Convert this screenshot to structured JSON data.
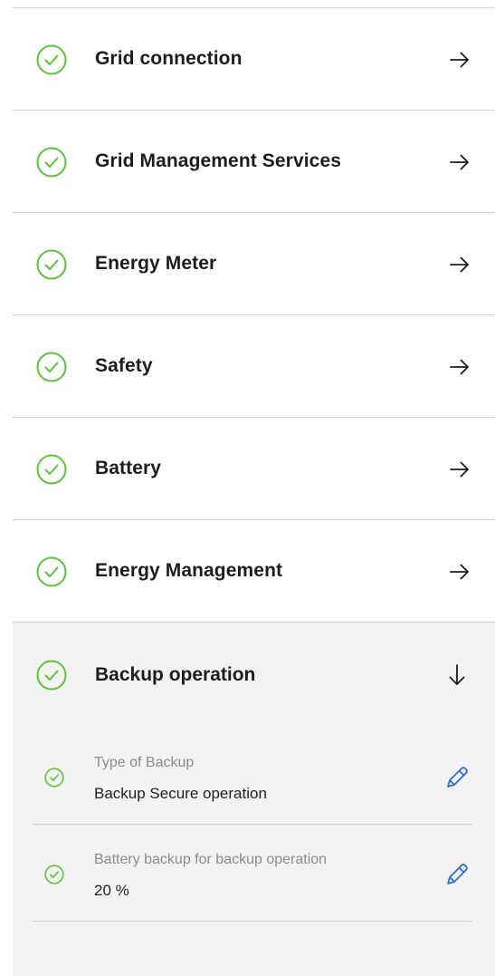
{
  "menu": {
    "items": [
      {
        "label": "Grid connection",
        "icon": "check-circle-icon",
        "action": "arrow-right-icon"
      },
      {
        "label": "Grid Management Services",
        "icon": "check-circle-icon",
        "action": "arrow-right-icon"
      },
      {
        "label": "Energy Meter",
        "icon": "check-circle-icon",
        "action": "arrow-right-icon"
      },
      {
        "label": "Safety",
        "icon": "check-circle-icon",
        "action": "arrow-right-icon"
      },
      {
        "label": "Battery",
        "icon": "check-circle-icon",
        "action": "arrow-right-icon"
      },
      {
        "label": "Energy Management",
        "icon": "check-circle-icon",
        "action": "arrow-right-icon"
      }
    ]
  },
  "expanded": {
    "label": "Backup operation",
    "icon": "check-circle-icon",
    "action": "arrow-down-icon",
    "settings": [
      {
        "label": "Type of Backup",
        "value": "Backup Secure operation",
        "icon": "pencil-icon"
      },
      {
        "label": "Battery backup for backup operation",
        "value": "20 %",
        "icon": "pencil-icon"
      }
    ]
  },
  "colors": {
    "check_green": "#5cc23a",
    "edit_blue": "#2a6fd6",
    "divider": "#d3d3d3",
    "expanded_bg": "#f3f3f3",
    "text_primary": "#1d1d1d",
    "text_secondary": "#8a8a8a"
  }
}
